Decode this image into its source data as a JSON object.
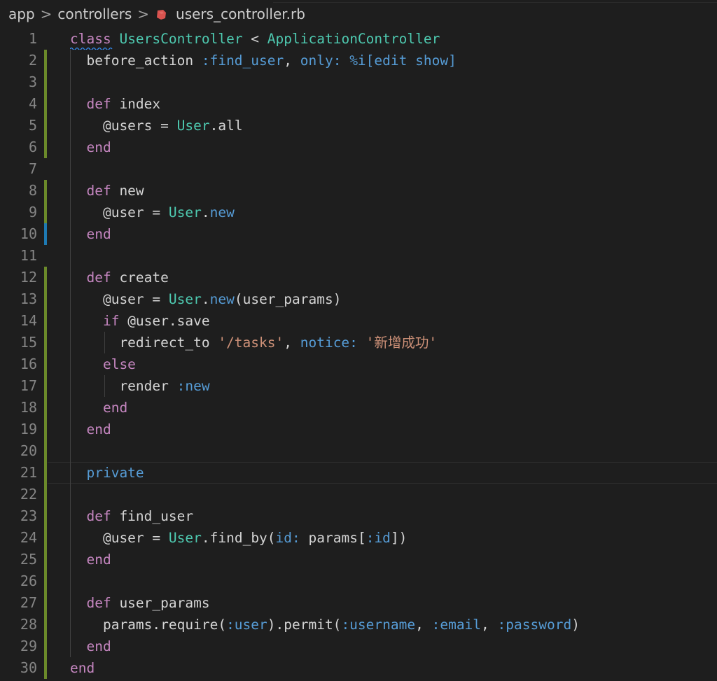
{
  "breadcrumb": {
    "items": [
      "app",
      "controllers",
      "users_controller.rb"
    ],
    "separator": ">",
    "file_icon": "ruby-icon"
  },
  "colors": {
    "background": "#1e1e1e",
    "line_number": "#858585",
    "keyword": "#c586c0",
    "class": "#4ec9b0",
    "symbol": "#569cd6",
    "string": "#ce9178",
    "plain": "#d4d4d4",
    "gutter_modified": "#6b8a2a",
    "gutter_added": "#1e7ab3"
  },
  "editor": {
    "lines": [
      {
        "n": "1",
        "tokens": [
          {
            "t": "class",
            "c": "kw"
          },
          {
            "t": " ",
            "c": "plain"
          },
          {
            "t": "UsersController",
            "c": "cls"
          },
          {
            "t": " < ",
            "c": "plain"
          },
          {
            "t": "ApplicationController",
            "c": "cls"
          }
        ]
      },
      {
        "n": "2",
        "tokens": [
          {
            "t": "  before_action ",
            "c": "plain"
          },
          {
            "t": ":find_user",
            "c": "sym"
          },
          {
            "t": ", ",
            "c": "plain"
          },
          {
            "t": "only:",
            "c": "sym"
          },
          {
            "t": " ",
            "c": "plain"
          },
          {
            "t": "%i[edit show]",
            "c": "sym"
          }
        ]
      },
      {
        "n": "3",
        "tokens": []
      },
      {
        "n": "4",
        "tokens": [
          {
            "t": "  def",
            "c": "kw"
          },
          {
            "t": " index",
            "c": "plain"
          }
        ]
      },
      {
        "n": "5",
        "tokens": [
          {
            "t": "    @users",
            "c": "plain"
          },
          {
            "t": " = ",
            "c": "plain"
          },
          {
            "t": "User",
            "c": "cls"
          },
          {
            "t": ".all",
            "c": "plain"
          }
        ]
      },
      {
        "n": "6",
        "tokens": [
          {
            "t": "  end",
            "c": "kw"
          }
        ]
      },
      {
        "n": "7",
        "tokens": []
      },
      {
        "n": "8",
        "tokens": [
          {
            "t": "  def",
            "c": "kw"
          },
          {
            "t": " new",
            "c": "plain"
          }
        ]
      },
      {
        "n": "9",
        "tokens": [
          {
            "t": "    @user",
            "c": "plain"
          },
          {
            "t": " = ",
            "c": "plain"
          },
          {
            "t": "User",
            "c": "cls"
          },
          {
            "t": ".",
            "c": "plain"
          },
          {
            "t": "new",
            "c": "sym"
          }
        ]
      },
      {
        "n": "10",
        "tokens": [
          {
            "t": "  end",
            "c": "kw"
          }
        ]
      },
      {
        "n": "11",
        "tokens": []
      },
      {
        "n": "12",
        "tokens": [
          {
            "t": "  def",
            "c": "kw"
          },
          {
            "t": " create",
            "c": "plain"
          }
        ]
      },
      {
        "n": "13",
        "tokens": [
          {
            "t": "    @user",
            "c": "plain"
          },
          {
            "t": " = ",
            "c": "plain"
          },
          {
            "t": "User",
            "c": "cls"
          },
          {
            "t": ".",
            "c": "plain"
          },
          {
            "t": "new",
            "c": "sym"
          },
          {
            "t": "(user_params)",
            "c": "plain"
          }
        ]
      },
      {
        "n": "14",
        "tokens": [
          {
            "t": "    if",
            "c": "kw"
          },
          {
            "t": " @user.save",
            "c": "plain"
          }
        ]
      },
      {
        "n": "15",
        "tokens": [
          {
            "t": "      redirect_to ",
            "c": "plain"
          },
          {
            "t": "'/tasks'",
            "c": "str"
          },
          {
            "t": ", ",
            "c": "plain"
          },
          {
            "t": "notice:",
            "c": "sym"
          },
          {
            "t": " ",
            "c": "plain"
          },
          {
            "t": "'新增成功'",
            "c": "str"
          }
        ]
      },
      {
        "n": "16",
        "tokens": [
          {
            "t": "    else",
            "c": "kw"
          }
        ]
      },
      {
        "n": "17",
        "tokens": [
          {
            "t": "      render ",
            "c": "plain"
          },
          {
            "t": ":new",
            "c": "sym"
          }
        ]
      },
      {
        "n": "18",
        "tokens": [
          {
            "t": "    end",
            "c": "kw"
          }
        ]
      },
      {
        "n": "19",
        "tokens": [
          {
            "t": "  end",
            "c": "kw"
          }
        ]
      },
      {
        "n": "20",
        "tokens": []
      },
      {
        "n": "21",
        "tokens": [
          {
            "t": "  private",
            "c": "sym"
          }
        ]
      },
      {
        "n": "22",
        "tokens": []
      },
      {
        "n": "23",
        "tokens": [
          {
            "t": "  def",
            "c": "kw"
          },
          {
            "t": " find_user",
            "c": "plain"
          }
        ]
      },
      {
        "n": "24",
        "tokens": [
          {
            "t": "    @user",
            "c": "plain"
          },
          {
            "t": " = ",
            "c": "plain"
          },
          {
            "t": "User",
            "c": "cls"
          },
          {
            "t": ".find_by(",
            "c": "plain"
          },
          {
            "t": "id:",
            "c": "sym"
          },
          {
            "t": " params[",
            "c": "plain"
          },
          {
            "t": ":id",
            "c": "sym"
          },
          {
            "t": "])",
            "c": "plain"
          }
        ]
      },
      {
        "n": "25",
        "tokens": [
          {
            "t": "  end",
            "c": "kw"
          }
        ]
      },
      {
        "n": "26",
        "tokens": []
      },
      {
        "n": "27",
        "tokens": [
          {
            "t": "  def",
            "c": "kw"
          },
          {
            "t": " user_params",
            "c": "plain"
          }
        ]
      },
      {
        "n": "28",
        "tokens": [
          {
            "t": "    params.require(",
            "c": "plain"
          },
          {
            "t": ":user",
            "c": "sym"
          },
          {
            "t": ").permit(",
            "c": "plain"
          },
          {
            "t": ":username",
            "c": "sym"
          },
          {
            "t": ", ",
            "c": "plain"
          },
          {
            "t": ":email",
            "c": "sym"
          },
          {
            "t": ", ",
            "c": "plain"
          },
          {
            "t": ":password",
            "c": "sym"
          },
          {
            "t": ")",
            "c": "plain"
          }
        ]
      },
      {
        "n": "29",
        "tokens": [
          {
            "t": "  end",
            "c": "kw"
          }
        ]
      },
      {
        "n": "30",
        "tokens": [
          {
            "t": "end",
            "c": "kw"
          }
        ]
      }
    ]
  }
}
